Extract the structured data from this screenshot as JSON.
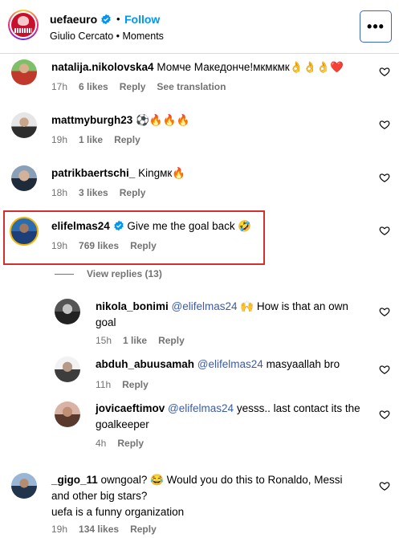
{
  "header": {
    "username": "uefaeuro",
    "separator": "•",
    "follow_label": "Follow",
    "subtitle": "Giulio Cercato • Moments",
    "more_label": "•••"
  },
  "comments": [
    {
      "username": "natalija.nikolovska4",
      "text": "Момче Македонче!мкмкмк👌👌👌❤️",
      "time": "17h",
      "likes": "6 likes",
      "reply": "Reply",
      "translate": "See translation"
    },
    {
      "username": "mattmyburgh23",
      "text": "⚽🔥🔥🔥",
      "time": "19h",
      "likes": "1 like",
      "reply": "Reply"
    },
    {
      "username": "patrikbaertschi_",
      "text": "Kingмк🔥",
      "time": "18h",
      "likes": "3 likes",
      "reply": "Reply"
    },
    {
      "username": "elifelmas24",
      "text": "Give me the goal back 🤣",
      "time": "19h",
      "likes": "769 likes",
      "reply": "Reply"
    }
  ],
  "view_replies": "View replies (13)",
  "replies": [
    {
      "username": "nikola_bonimi",
      "mention": "@elifelmas24",
      "text_line1": "🙌 How is that an own",
      "text_line2": "goal",
      "time": "15h",
      "likes": "1 like",
      "reply": "Reply"
    },
    {
      "username": "abduh_abuusamah",
      "mention": "@elifelmas24",
      "text_line1": "masyaallah bro",
      "time": "11h",
      "reply": "Reply"
    },
    {
      "username": "jovicaeftimov",
      "mention": "@elifelmas24",
      "text_line1": "yesss.. last contact its the",
      "text_line2": "goalkeeper",
      "time": "4h",
      "reply": "Reply"
    }
  ],
  "last_comment": {
    "username": "_gigo_11",
    "text_line1": "owngoal? 😂 Would you do this to Ronaldo, Messi",
    "text_line2": "and other big stars?",
    "text_line3": "uefa is a funny organization",
    "time": "19h",
    "likes": "134 likes",
    "reply": "Reply"
  },
  "colors": {
    "follow": "#0095f6",
    "verified": "#0095f6",
    "mention": "#3b5ba8",
    "highlight": "#d32f2f",
    "meta": "#737373"
  },
  "icons": {
    "verified": "verified-badge-icon",
    "heart": "heart-outline-icon",
    "more": "more-options-icon"
  }
}
